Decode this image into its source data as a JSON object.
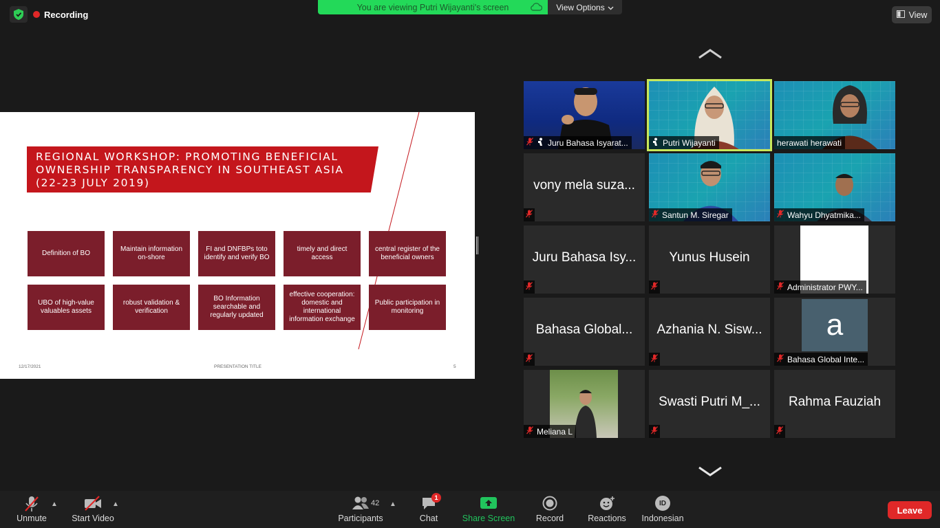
{
  "topbar": {
    "recording_label": "Recording",
    "viewing_banner": "You are viewing Putri Wijayanti's screen",
    "view_options_label": "View Options",
    "view_label": "View"
  },
  "slide": {
    "title": "REGIONAL WORKSHOP: PROMOTING BENEFICIAL\nOWNERSHIP TRANSPARENCY IN SOUTHEAST ASIA\n(22-23 JULY 2019)",
    "boxes": [
      "Definition of BO",
      "Maintain information on-shore",
      "FI and DNFBPs toto identify and verify BO",
      "timely and direct access",
      "central register of the beneficial owners",
      "UBO of high-value valuables assets",
      "robust validation & verification",
      "BO Information searchable and regularly updated",
      "effective cooperation: domestic and international information exchange",
      "Public participation in monitoring"
    ],
    "footer_date": "12/17/2021",
    "footer_title": "PRESENTATION TITLE",
    "footer_page": "5",
    "accent_color": "#c4161c",
    "box_color": "#7b1e2b"
  },
  "participants": [
    {
      "name": "Juru Bahasa Isyarat...",
      "label": "Juru Bahasa Isyarat...",
      "display": "video"
    },
    {
      "name": "Putri Wijayanti",
      "label": "Putri Wijayanti",
      "display": "video-active"
    },
    {
      "name": "herawati herawati",
      "label": "herawati herawati",
      "display": "video"
    },
    {
      "name": "vony mela suza...",
      "label": "",
      "display": "name"
    },
    {
      "name": "Santun M. Siregar",
      "label": "Santun M. Siregar",
      "display": "video"
    },
    {
      "name": "Wahyu Dhyatmika...",
      "label": "Wahyu Dhyatmika...",
      "display": "video"
    },
    {
      "name": "Juru Bahasa Isy...",
      "label": "",
      "display": "name"
    },
    {
      "name": "Yunus Husein",
      "label": "",
      "display": "name"
    },
    {
      "name": "Administrator PWY...",
      "label": "Administrator PWY...",
      "display": "white"
    },
    {
      "name": "Bahasa Global...",
      "label": "",
      "display": "name"
    },
    {
      "name": "Azhania N. Sisw...",
      "label": "",
      "display": "name"
    },
    {
      "name": "Bahasa Global Inte...",
      "label": "Bahasa Global Inte...",
      "display": "avatar",
      "avatar_letter": "a"
    },
    {
      "name": "Meliana L",
      "label": "Meliana L",
      "display": "photo"
    },
    {
      "name": "Swasti Putri M_...",
      "label": "",
      "display": "name"
    },
    {
      "name": "Rahma Fauziah",
      "label": "",
      "display": "name"
    }
  ],
  "toolbar": {
    "unmute_label": "Unmute",
    "start_video_label": "Start Video",
    "participants_label": "Participants",
    "participants_count": "42",
    "chat_label": "Chat",
    "chat_badge": "1",
    "share_screen_label": "Share Screen",
    "record_label": "Record",
    "reactions_label": "Reactions",
    "language_label": "Indonesian",
    "language_badge": "ID",
    "leave_label": "Leave"
  },
  "colors": {
    "banner_green": "#23d959",
    "share_green": "#21c45d",
    "leave_red": "#e02828",
    "active_border": "#c8e85a",
    "muted_red": "#e02828"
  }
}
